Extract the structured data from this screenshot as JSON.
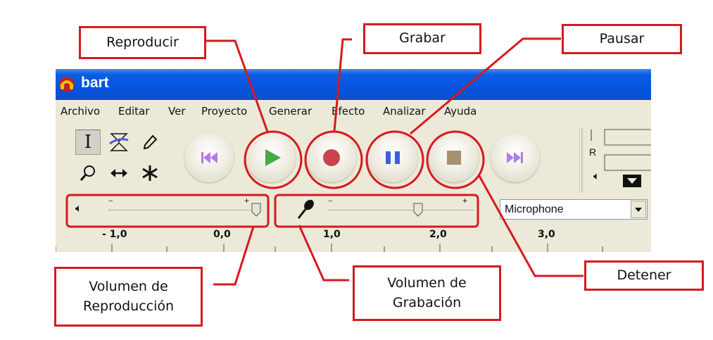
{
  "window": {
    "title": "bart",
    "menu": [
      "Archivo",
      "Editar",
      "Ver",
      "Proyecto",
      "Generar",
      "Efecto",
      "Analizar",
      "Ayuda"
    ]
  },
  "transport": {
    "buttons": [
      "skip-start",
      "play",
      "record",
      "pause",
      "stop",
      "skip-end"
    ]
  },
  "meter": {
    "channel_label": "R"
  },
  "mixer": {
    "playback_level": 1.0,
    "recording_level": 0.62,
    "input_source": "Microphone"
  },
  "ruler": {
    "labels": [
      "- 1,0",
      "0,0",
      "1,0",
      "2,0",
      "3,0"
    ]
  },
  "callouts": {
    "play": "Reproducir",
    "record": "Grabar",
    "pause": "Pausar",
    "stop": "Detener",
    "playback_volume": "Volumen de\nReproducción",
    "recording_volume": "Volumen de\nGrabación"
  },
  "colors": {
    "callout_red": "#d7191f",
    "titlebar_blue": "#0554e0",
    "play_green": "#44aa44",
    "record_red": "#c8434b",
    "pause_blue": "#3b5fe0",
    "stop_brown": "#a89070",
    "skip_purple": "#b37be6"
  }
}
